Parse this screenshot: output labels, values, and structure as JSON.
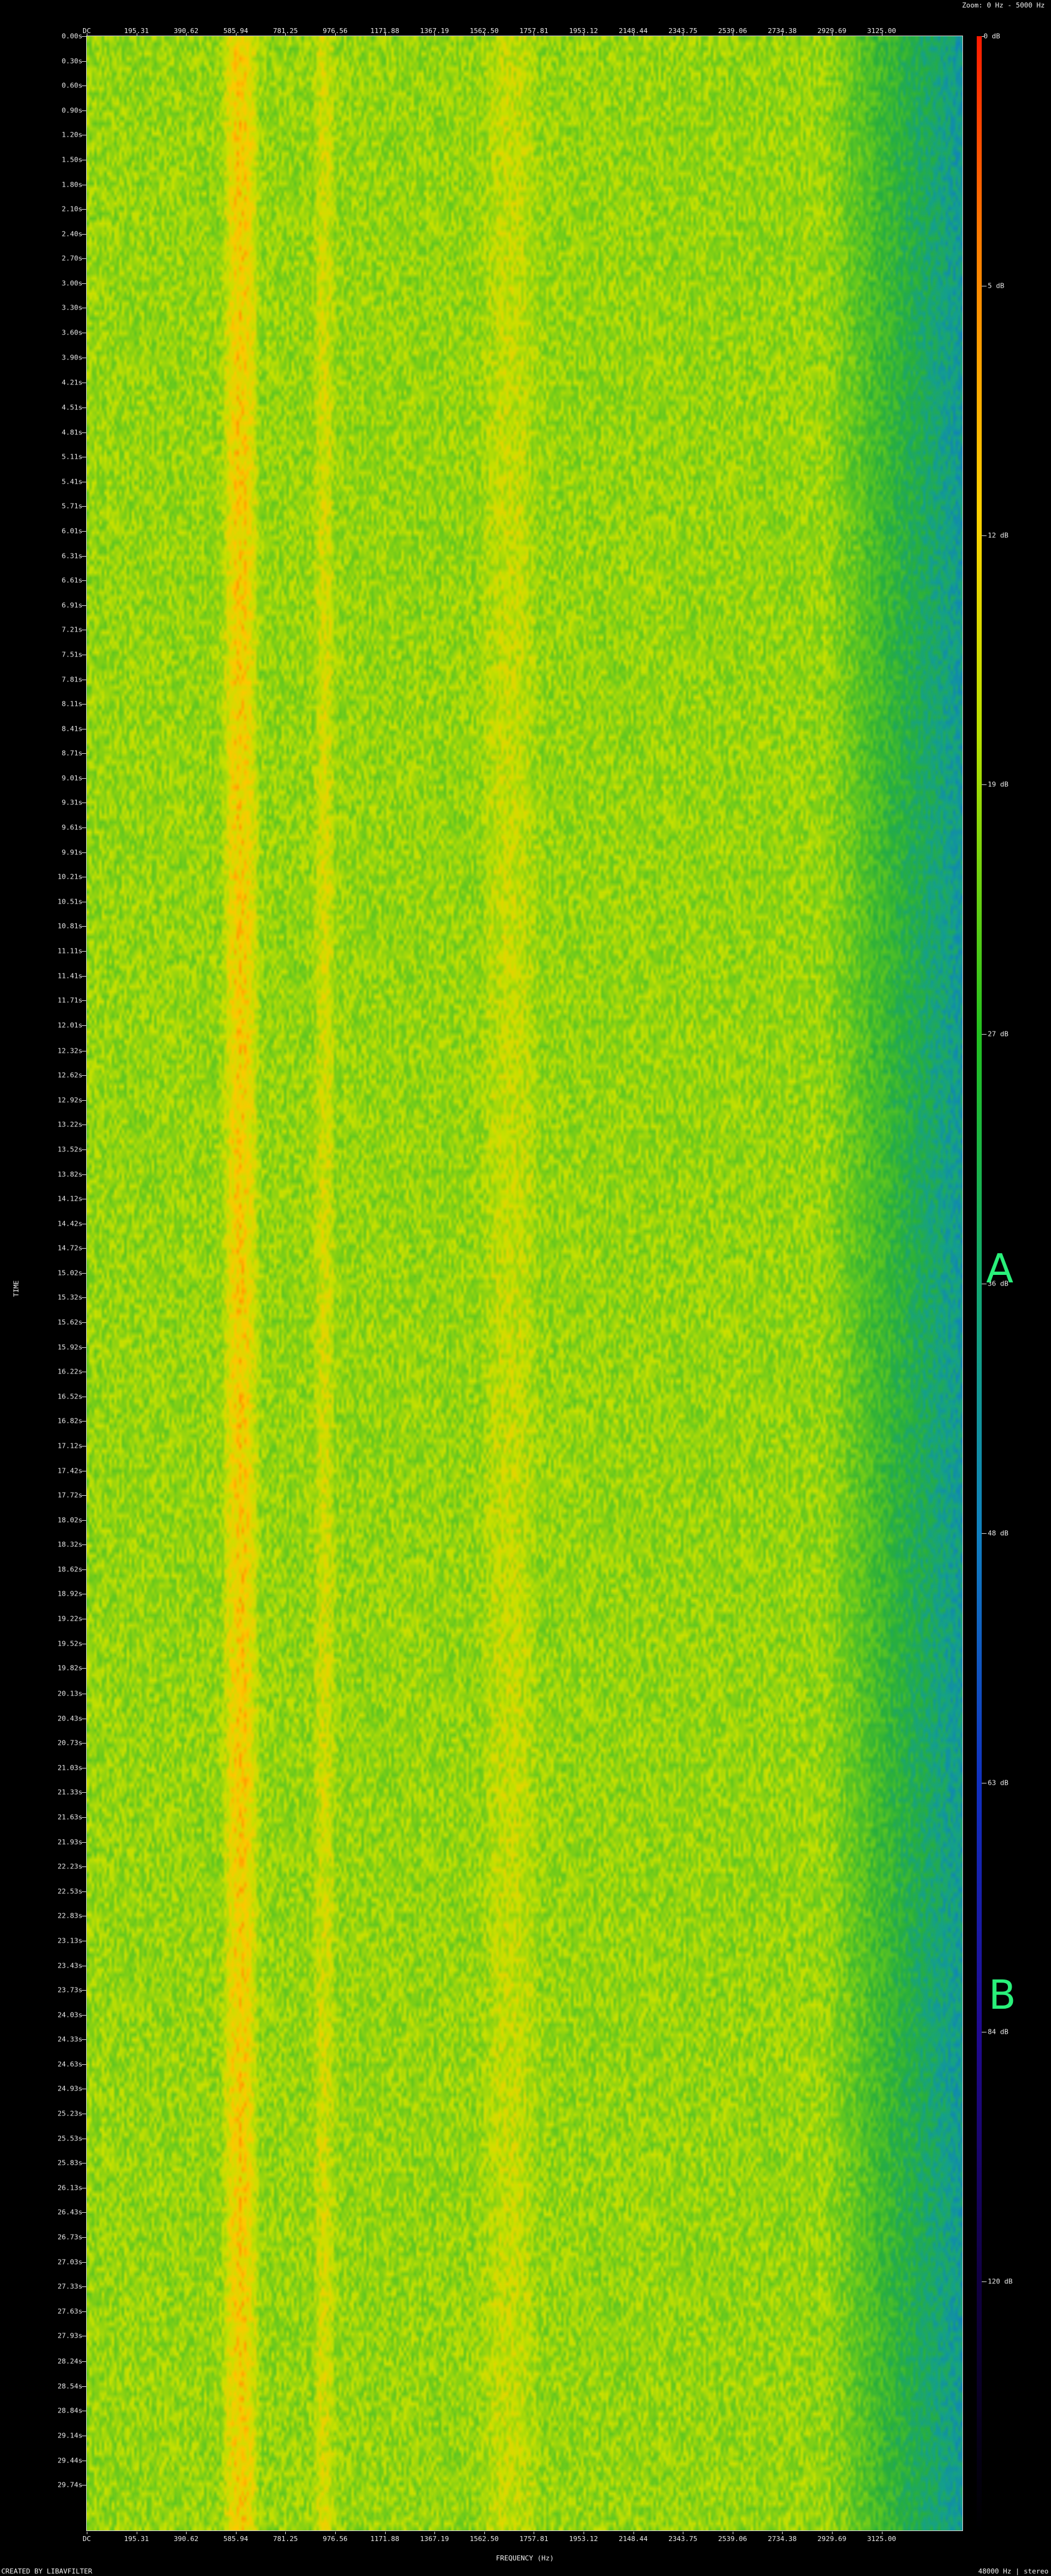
{
  "header": {
    "zoom": "Zoom: 0 Hz - 5000 Hz"
  },
  "footer": {
    "credit": "CREATED BY LIBAVFILTER",
    "rate": "48000 Hz | stereo"
  },
  "annotations": {
    "a": "A",
    "b": "B"
  },
  "chart_data": {
    "type": "heatmap",
    "title": "",
    "xlabel": "FREQUENCY (Hz)",
    "ylabel": "TIME",
    "xlim": [
      0,
      3445
    ],
    "ylim": [
      0,
      30.3
    ],
    "grid": false,
    "x_ticks": [
      "DC",
      "195.31",
      "390.62",
      "585.94",
      "781.25",
      "976.56",
      "1171.88",
      "1367.19",
      "1562.50",
      "1757.81",
      "1953.12",
      "2148.44",
      "2343.75",
      "2539.06",
      "2734.38",
      "2929.69",
      "3125.00"
    ],
    "y_ticks": [
      "0.00s",
      "0.30s",
      "0.60s",
      "0.90s",
      "1.20s",
      "1.50s",
      "1.80s",
      "2.10s",
      "2.40s",
      "2.70s",
      "3.00s",
      "3.30s",
      "3.60s",
      "3.90s",
      "4.21s",
      "4.51s",
      "4.81s",
      "5.11s",
      "5.41s",
      "5.71s",
      "6.01s",
      "6.31s",
      "6.61s",
      "6.91s",
      "7.21s",
      "7.51s",
      "7.81s",
      "8.11s",
      "8.41s",
      "8.71s",
      "9.01s",
      "9.31s",
      "9.61s",
      "9.91s",
      "10.21s",
      "10.51s",
      "10.81s",
      "11.11s",
      "11.41s",
      "11.71s",
      "12.01s",
      "12.32s",
      "12.62s",
      "12.92s",
      "13.22s",
      "13.52s",
      "13.82s",
      "14.12s",
      "14.42s",
      "14.72s",
      "15.02s",
      "15.32s",
      "15.62s",
      "15.92s",
      "16.22s",
      "16.52s",
      "16.82s",
      "17.12s",
      "17.42s",
      "17.72s",
      "18.02s",
      "18.32s",
      "18.62s",
      "18.92s",
      "19.22s",
      "19.52s",
      "19.82s",
      "20.13s",
      "20.43s",
      "20.73s",
      "21.03s",
      "21.33s",
      "21.63s",
      "21.93s",
      "22.23s",
      "22.53s",
      "22.83s",
      "23.13s",
      "23.43s",
      "23.73s",
      "24.03s",
      "24.33s",
      "24.63s",
      "24.93s",
      "25.23s",
      "25.53s",
      "25.83s",
      "26.13s",
      "26.43s",
      "26.73s",
      "27.03s",
      "27.33s",
      "27.63s",
      "27.93s",
      "28.24s",
      "28.54s",
      "28.84s",
      "29.14s",
      "29.44s",
      "29.74s"
    ],
    "colorbar": {
      "labels": [
        "0 dB",
        "-5 dB",
        "-12 dB",
        "-19 dB",
        "-27 dB",
        "-36 dB",
        "-48 dB",
        "-63 dB",
        "-84 dB",
        "-120 dB"
      ],
      "values_db": [
        0,
        -5,
        -12,
        -19,
        -27,
        -36,
        -48,
        -63,
        -84,
        -120
      ]
    },
    "frequency_bands": [
      {
        "center_hz": 0,
        "width_hz": 120,
        "level_db": -38
      },
      {
        "center_hz": 600,
        "width_hz": 100,
        "level_db": -15
      },
      {
        "center_hz": 930,
        "width_hz": 80,
        "level_db": -22
      },
      {
        "center_hz": 1660,
        "width_hz": 240,
        "level_db": -24
      },
      {
        "center_hz": 2100,
        "width_hz": 1000,
        "level_db": -30
      },
      {
        "center_hz": 3200,
        "width_hz": 300,
        "level_db": -58
      }
    ]
  }
}
